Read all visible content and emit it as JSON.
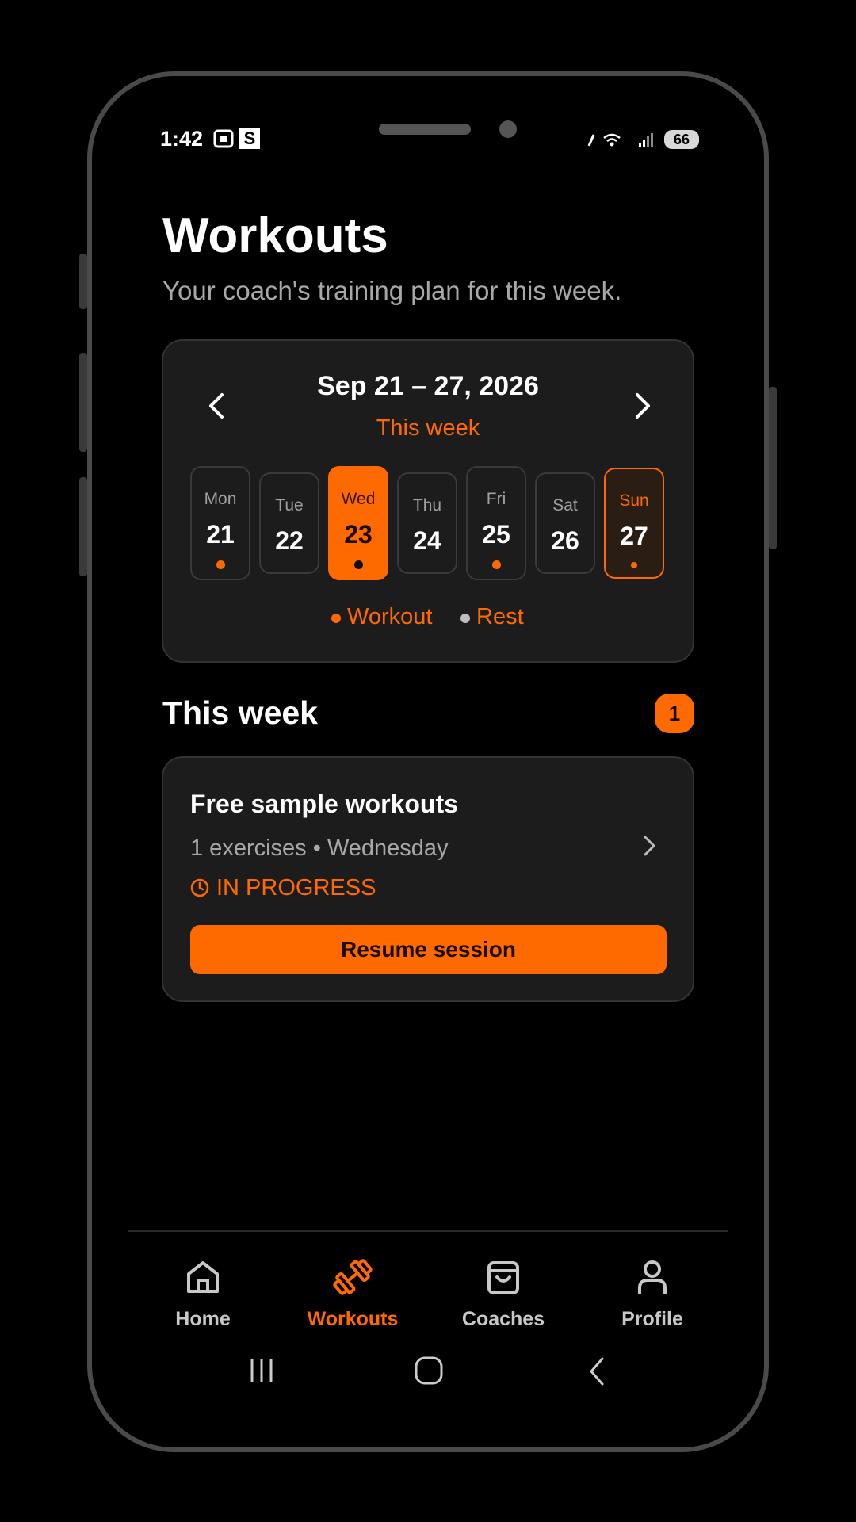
{
  "status_bar": {
    "time": "1:42",
    "battery": "66"
  },
  "header": {
    "title": "Workouts",
    "subtitle": "Your coach's training plan for this week."
  },
  "week_card": {
    "range": "Sep 21 – 27, 2026",
    "label": "This week",
    "days": [
      {
        "name": "Mon",
        "date": "21",
        "dot": "workout"
      },
      {
        "name": "Tue",
        "date": "22",
        "dot": "none"
      },
      {
        "name": "Wed",
        "date": "23",
        "dot": "workout",
        "selected": true
      },
      {
        "name": "Thu",
        "date": "24",
        "dot": "none"
      },
      {
        "name": "Fri",
        "date": "25",
        "dot": "workout"
      },
      {
        "name": "Sat",
        "date": "26",
        "dot": "none"
      },
      {
        "name": "Sun",
        "date": "27",
        "dot": "workout",
        "today": true
      }
    ],
    "legend": {
      "workout": "Workout",
      "rest": "Rest"
    }
  },
  "section": {
    "title": "This week",
    "count": "1"
  },
  "workout": {
    "title": "Free sample workouts",
    "meta": "1 exercises • Wednesday",
    "status": "IN PROGRESS",
    "button": "Resume session"
  },
  "nav": {
    "home": "Home",
    "workouts": "Workouts",
    "coaches": "Coaches",
    "profile": "Profile"
  },
  "colors": {
    "accent": "#ff6a00",
    "card": "#1c1c1c",
    "background": "#000000"
  }
}
